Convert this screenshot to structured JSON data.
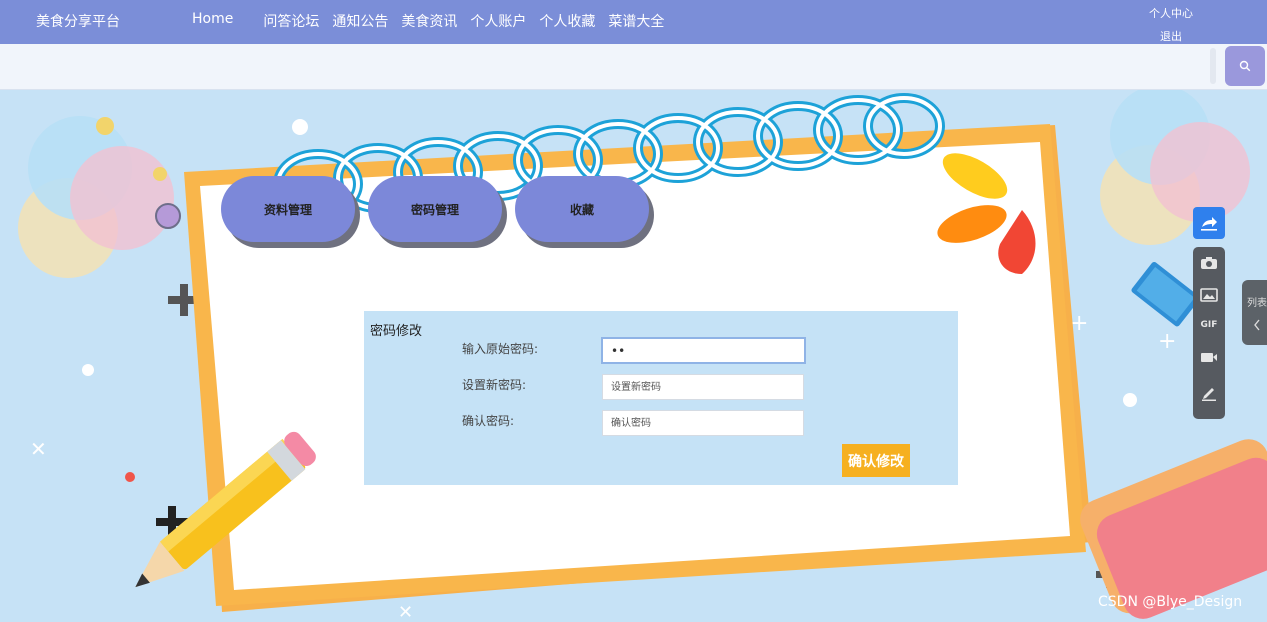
{
  "nav": {
    "brand": "美食分享平台",
    "home": "Home",
    "items": [
      "问答论坛",
      "通知公告",
      "美食资讯",
      "个人账户",
      "个人收藏",
      "菜谱大全"
    ],
    "user_center": "个人中心",
    "logout": "退出"
  },
  "search": {
    "placeholder": "",
    "icon": "search-icon"
  },
  "tabs": [
    "资料管理",
    "密码管理",
    "收藏"
  ],
  "form": {
    "title": "密码修改",
    "fields": [
      {
        "label": "输入原始密码:",
        "value": "••",
        "placeholder": ""
      },
      {
        "label": "设置新密码:",
        "value": "",
        "placeholder": "设置新密码"
      },
      {
        "label": "确认密码:",
        "value": "",
        "placeholder": "确认密码"
      }
    ],
    "submit": "确认修改"
  },
  "toolbar": {
    "icons": [
      "share-icon",
      "camera-icon",
      "image-icon",
      "gif-icon",
      "video-icon",
      "pen-icon"
    ],
    "gif_label": "GIF",
    "list_label": "列表"
  },
  "watermark": "CSDN @Blye_Design",
  "colors": {
    "nav_bg": "#7b8ed8",
    "tab_bg": "#7c88d9",
    "accent_button": "#f6b020",
    "background": "#c6e2f6",
    "share_button": "#2f80ed"
  }
}
